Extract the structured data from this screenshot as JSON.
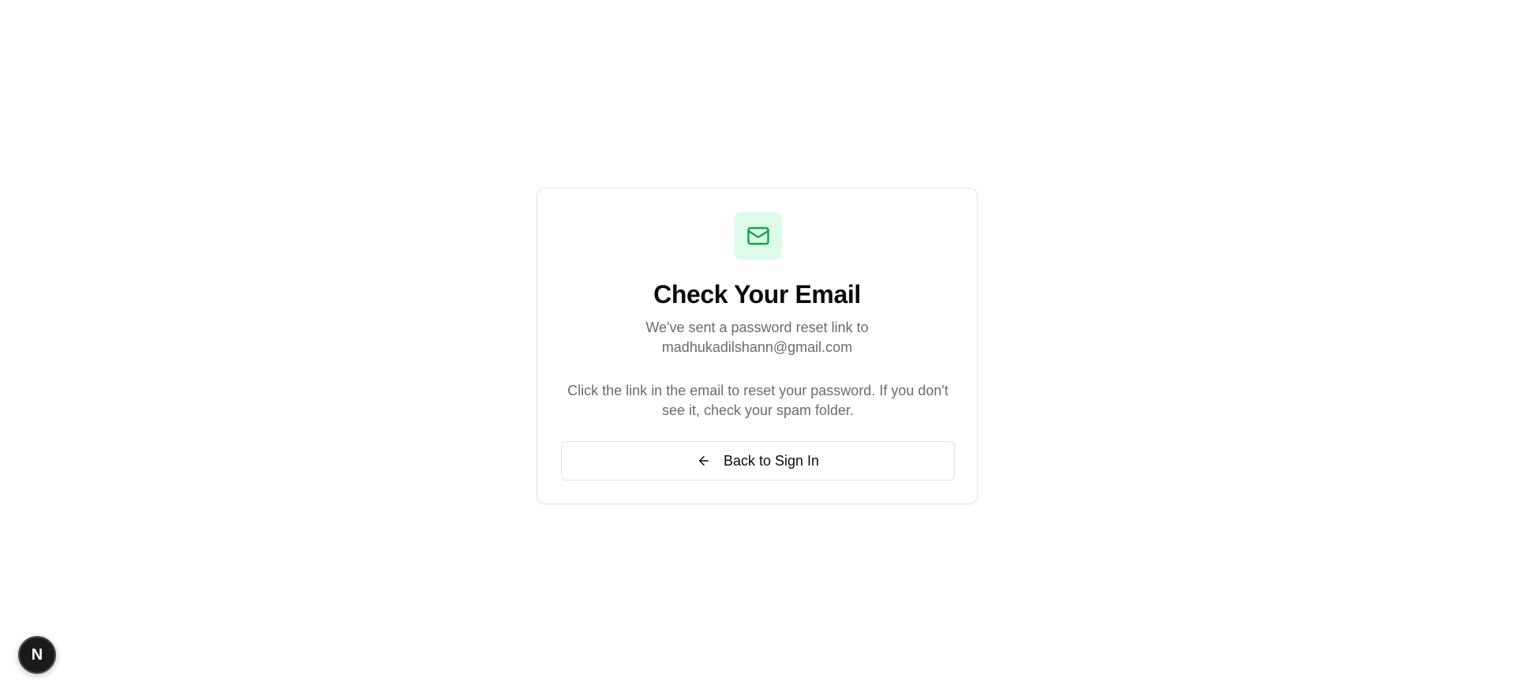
{
  "card": {
    "icon": "mail-icon",
    "title": "Check Your Email",
    "subtitle_line1": "We've sent a password reset link to",
    "email": "madhukadilshann@gmail.com",
    "info_text": "Click the link in the email to reset your password. If you don't see it, check your spam folder.",
    "back_button_label": "Back to Sign In",
    "back_button_icon": "arrow-left-icon"
  },
  "dev_badge": {
    "label": "N",
    "icon": "nextjs-icon"
  },
  "colors": {
    "accent": "#16a34a",
    "icon_bg": "#dcfce7",
    "muted_text": "#6b6b73",
    "border": "#e4e4e7"
  }
}
